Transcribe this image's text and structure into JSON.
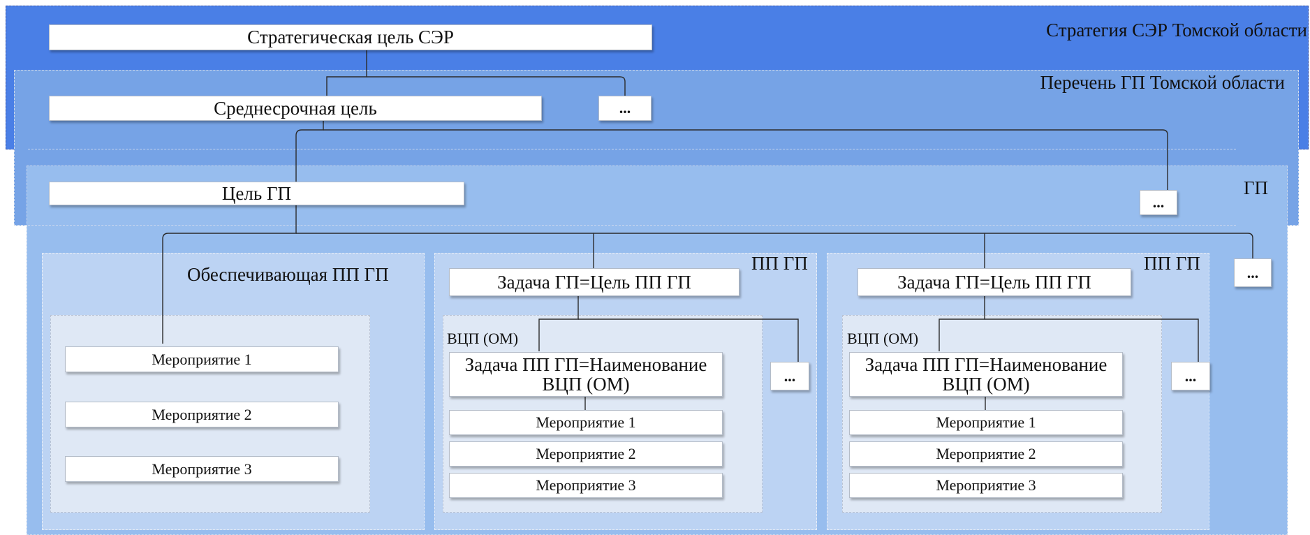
{
  "regions": {
    "strategy": "Стратегия СЭР Томской области",
    "program_list": "Перечень ГП Томской области",
    "program": "ГП"
  },
  "top": {
    "strategic_goal": "Стратегическая цель СЭР",
    "medium_goal": "Среднесрочная цель",
    "program_goal": "Цель ГП",
    "ellipsis": "..."
  },
  "support_subprogram": {
    "title": "Обеспечивающая ПП ГП",
    "activities": [
      "Мероприятие 1",
      "Мероприятие 2",
      "Мероприятие 3"
    ]
  },
  "subprograms": [
    {
      "title": "ПП ГП",
      "task": "Задача ГП=Цель ПП ГП",
      "vcp_label": "ВЦП (ОМ)",
      "vcp_task_line1": "Задача ПП ГП=Наименование",
      "vcp_task_line2": "ВЦП (ОМ)",
      "activities": [
        "Мероприятие 1",
        "Мероприятие 2",
        "Мероприятие 3"
      ],
      "ellipsis": "..."
    },
    {
      "title": "ПП ГП",
      "task": "Задача ГП=Цель ПП ГП",
      "vcp_label": "ВЦП (ОМ)",
      "vcp_task_line1": "Задача ПП ГП=Наименование",
      "vcp_task_line2": "ВЦП (ОМ)",
      "activities": [
        "Мероприятие 1",
        "Мероприятие 2",
        "Мероприятие 3"
      ],
      "ellipsis": "..."
    }
  ],
  "colors": {
    "strategy_bg": "#4a7fe6",
    "program_list_bg": "#76a3e6",
    "program_bg": "#97bdee",
    "subprogram_bg": "#bcd3f3",
    "inner_bg": "#dfe8f5"
  }
}
